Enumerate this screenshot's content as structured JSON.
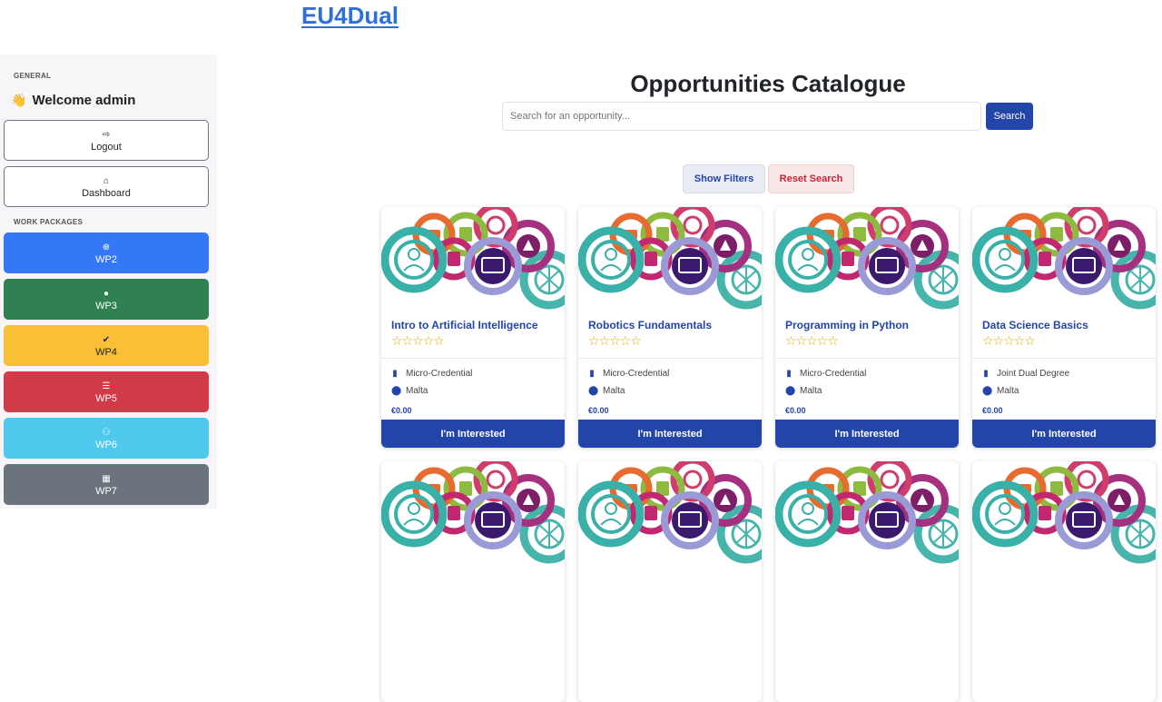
{
  "brand": "EU4Dual",
  "sidebar": {
    "general_label": "GENERAL",
    "welcome": "Welcome admin",
    "logout": "Logout",
    "dashboard": "Dashboard",
    "wp_label": "WORK PACKAGES",
    "wps": [
      {
        "label": "WP2",
        "icon": "globe-icon",
        "color": "#3478f6"
      },
      {
        "label": "WP3",
        "icon": "lightbulb-icon",
        "color": "#2f8151"
      },
      {
        "label": "WP4",
        "icon": "check-badge-icon",
        "color": "#f8bf37"
      },
      {
        "label": "WP5",
        "icon": "list-icon",
        "color": "#d23a47"
      },
      {
        "label": "WP6",
        "icon": "network-icon",
        "color": "#4fc9ee"
      },
      {
        "label": "WP7",
        "icon": "building-icon",
        "color": "#6b747c"
      }
    ]
  },
  "main": {
    "title": "Opportunities Catalogue",
    "search_placeholder": "Search for an opportunity...",
    "search_button": "Search",
    "show_filters": "Show Filters",
    "reset_search": "Reset Search"
  },
  "cards": [
    {
      "title": "Intro to Artificial Intelligence",
      "stars": "☆☆☆☆☆",
      "type": "Micro-Credential",
      "location": "Malta",
      "price": "€0.00",
      "button": "I'm Interested"
    },
    {
      "title": "Robotics Fundamentals",
      "stars": "☆☆☆☆☆",
      "type": "Micro-Credential",
      "location": "Malta",
      "price": "€0.00",
      "button": "I'm Interested"
    },
    {
      "title": "Programming in Python",
      "stars": "☆☆☆☆☆",
      "type": "Micro-Credential",
      "location": "Malta",
      "price": "€0.00",
      "button": "I'm Interested"
    },
    {
      "title": "Data Science Basics",
      "stars": "☆☆☆☆☆",
      "type": "Joint Dual Degree",
      "location": "Malta",
      "price": "€0.00",
      "button": "I'm Interested"
    }
  ],
  "colors": {
    "primary": "#2344a8",
    "brand_link": "#2f6fd8"
  }
}
